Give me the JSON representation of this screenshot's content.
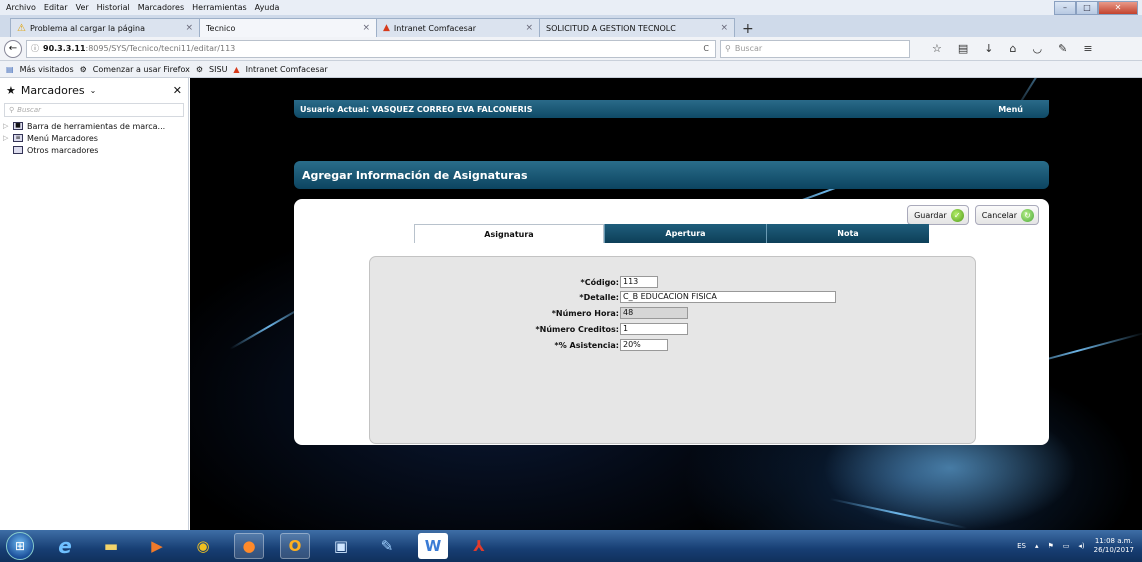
{
  "menubar": {
    "items": [
      "Archivo",
      "Editar",
      "Ver",
      "Historial",
      "Marcadores",
      "Herramientas",
      "Ayuda"
    ]
  },
  "tabs": [
    {
      "label": "Problema al cargar la página",
      "icon": "warning-icon"
    },
    {
      "label": "Tecnico",
      "icon": ""
    },
    {
      "label": "Intranet Comfacesar",
      "icon": "flame-icon"
    },
    {
      "label": "SOLICITUD A GESTION TECNOLC",
      "icon": ""
    }
  ],
  "newtab": "+",
  "nav": {
    "url_host": "90.3.3.11",
    "url_path": ":8095/SYS/Tecnico/tecni11/editar/113",
    "search_placeholder": "Buscar"
  },
  "bookmarks": {
    "items": [
      {
        "label": "Más visitados",
        "icon": "gear-icon"
      },
      {
        "label": "Comenzar a usar Firefox",
        "icon": "gear-icon"
      },
      {
        "label": "SISU",
        "icon": "gear-icon"
      },
      {
        "label": "Intranet Comfacesar",
        "icon": "flame-icon"
      }
    ]
  },
  "sidebar": {
    "title": "Marcadores",
    "search_placeholder": "Buscar",
    "items": [
      {
        "label": "Barra de herramientas de marca..."
      },
      {
        "label": "Menú Marcadores"
      },
      {
        "label": "Otros marcadores"
      }
    ]
  },
  "page": {
    "user_label": "Usuario Actual: VASQUEZ CORREO EVA FALCONERIS",
    "menu_label": "Menú",
    "title": "Agregar Información de Asignaturas",
    "save_label": "Guardar",
    "cancel_label": "Cancelar",
    "tabs": [
      "Asignatura",
      "Apertura",
      "Nota"
    ],
    "form": {
      "codigo_label": "*Código:",
      "codigo_value": "113",
      "detalle_label": "*Detalle:",
      "detalle_value": "C_B EDUCACION FISICA",
      "horas_label": "*Número Hora:",
      "horas_value": "48",
      "creditos_label": "*Número Creditos:",
      "creditos_value": "1",
      "asistencia_label": "*% Asistencia:",
      "asistencia_value": "20%"
    }
  },
  "taskbar": {
    "lang": "ES",
    "time": "11:08 a.m.",
    "date": "26/10/2017"
  }
}
